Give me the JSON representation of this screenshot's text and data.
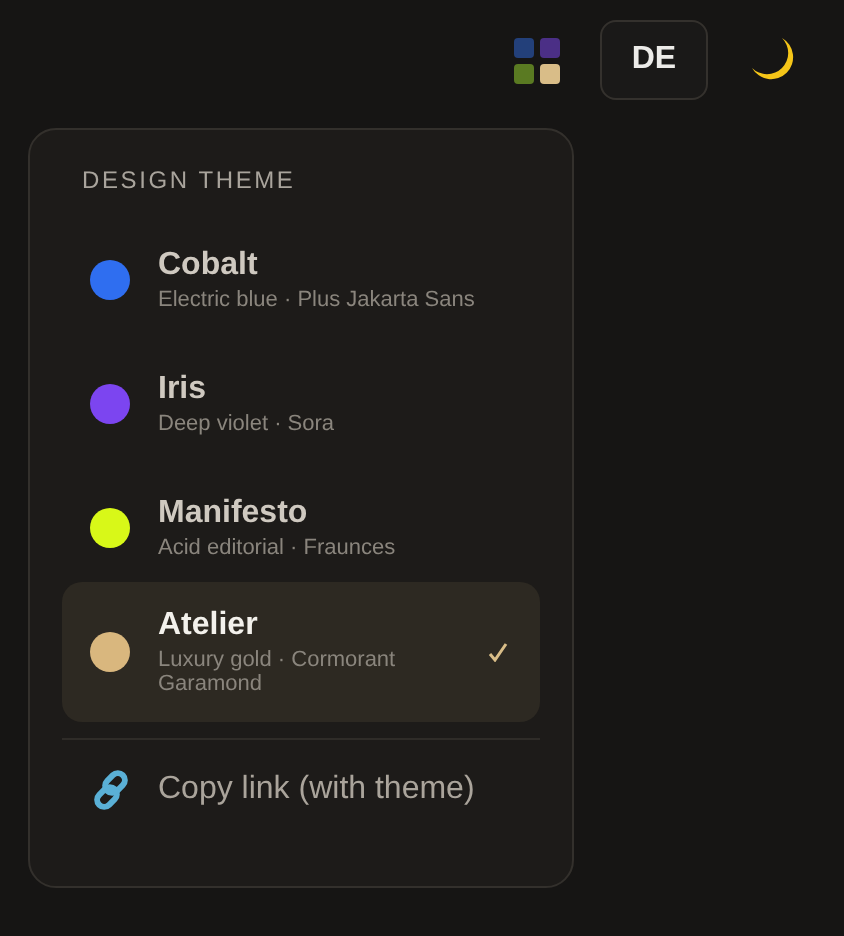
{
  "toolbar": {
    "language_button": "DE"
  },
  "menu": {
    "heading": "DESIGN THEME",
    "themes": [
      {
        "name": "Cobalt",
        "description": "Electric blue · Plus Jakarta Sans",
        "color": "#2f6ef0",
        "selected": false
      },
      {
        "name": "Iris",
        "description": "Deep violet · Sora",
        "color": "#7c45f0",
        "selected": false
      },
      {
        "name": "Manifesto",
        "description": "Acid editorial · Fraunces",
        "color": "#d8f818",
        "selected": false
      },
      {
        "name": "Atelier",
        "description": "Luxury gold · Cormorant Garamond",
        "color": "#d9b77e",
        "selected": true
      }
    ],
    "copy_link": "Copy link (with theme)"
  }
}
